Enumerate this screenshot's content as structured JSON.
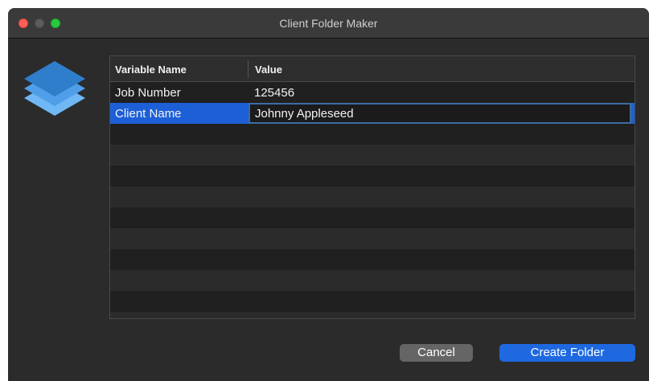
{
  "window": {
    "title": "Client Folder Maker"
  },
  "icons": {
    "app": "stacked-layers-icon",
    "close": "close-window-icon",
    "minimize": "minimize-window-icon",
    "zoom": "zoom-window-icon"
  },
  "table": {
    "columns": [
      "Variable Name",
      "Value"
    ],
    "rows": [
      {
        "name": "Job Number",
        "value": "125456"
      },
      {
        "name": "Client Name",
        "value": "Johnny Appleseed"
      }
    ],
    "selected_row": 1,
    "editing_value": "Johnny Appleseed"
  },
  "buttons": {
    "cancel": "Cancel",
    "create": "Create Folder"
  },
  "colors": {
    "selection": "#1d5fd6",
    "primary_button": "#1e69e0",
    "close": "#fe5f57",
    "zoom": "#28c840",
    "icon_blue": "#3d8fe0"
  }
}
